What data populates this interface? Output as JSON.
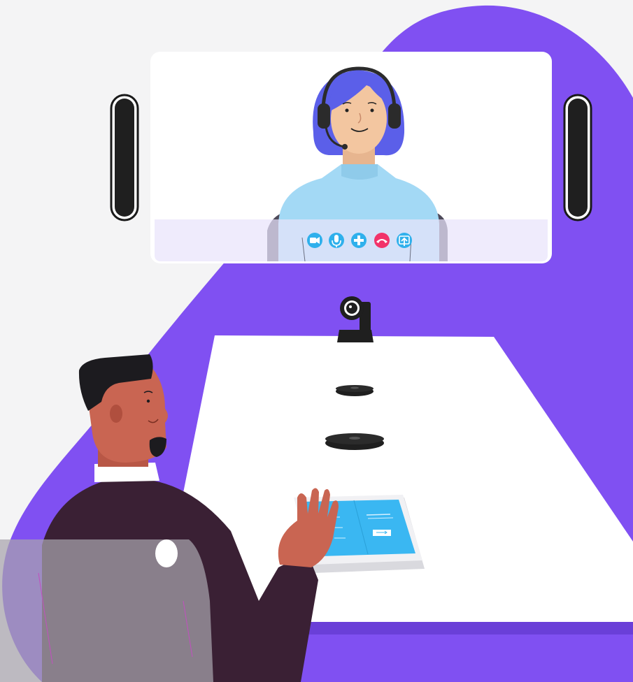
{
  "scene": {
    "background_color": "#f4f4f5",
    "blob_color": "#8050f2",
    "screen": {
      "frame_color": "#ffffff",
      "control_bar_color": "#e9e3fb",
      "call_controls": [
        {
          "icon": "video-camera-icon",
          "color": "#2fb0ec"
        },
        {
          "icon": "microphone-icon",
          "color": "#2fb0ec"
        },
        {
          "icon": "plus-icon",
          "color": "#2fb0ec"
        },
        {
          "icon": "hang-up-icon",
          "color": "#f2336a"
        },
        {
          "icon": "share-screen-icon",
          "color": "#2fb0ec"
        }
      ]
    },
    "remote_person": {
      "hair_color": "#5b5fe9",
      "skin_color": "#f3c6a0",
      "shirt_color": "#a3d9f5",
      "headset_color": "#2b2b2b"
    },
    "local_person": {
      "hair_color": "#1c1b1f",
      "skin_color": "#c96552",
      "jacket_color": "#3a2034"
    },
    "table_color": "#ffffff",
    "tablet": {
      "screen_color": "#3ab7f2"
    },
    "devices": [
      "conference-camera",
      "ceiling-microphone",
      "table-microphone",
      "soundbar-left",
      "soundbar-right"
    ]
  }
}
